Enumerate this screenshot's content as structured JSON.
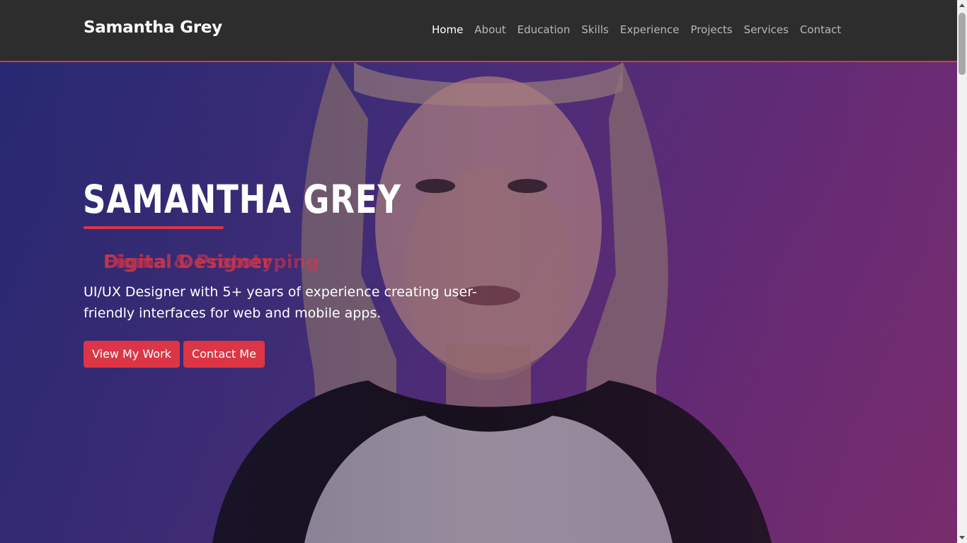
{
  "header": {
    "brand": "Samantha Grey",
    "nav": [
      {
        "label": "Home",
        "active": true
      },
      {
        "label": "About"
      },
      {
        "label": "Education"
      },
      {
        "label": "Skills"
      },
      {
        "label": "Experience"
      },
      {
        "label": "Projects"
      },
      {
        "label": "Services"
      },
      {
        "label": "Contact"
      }
    ]
  },
  "hero": {
    "title": "SAMANTHA GREY",
    "typed_text_a": "Digital Designer",
    "typed_text_b": "Figma & Prototyping",
    "description": "UI/UX Designer with 5+ years of experience creating user-friendly interfaces for web and mobile apps.",
    "buttons": {
      "view_work": "View My Work",
      "contact": "Contact Me"
    },
    "background": "portrait-photo"
  },
  "colors": {
    "accent": "#dc3545",
    "navbar": "#2d2d2d",
    "gradient_left": "#2c2f7e",
    "gradient_right": "#7b2e6c"
  }
}
